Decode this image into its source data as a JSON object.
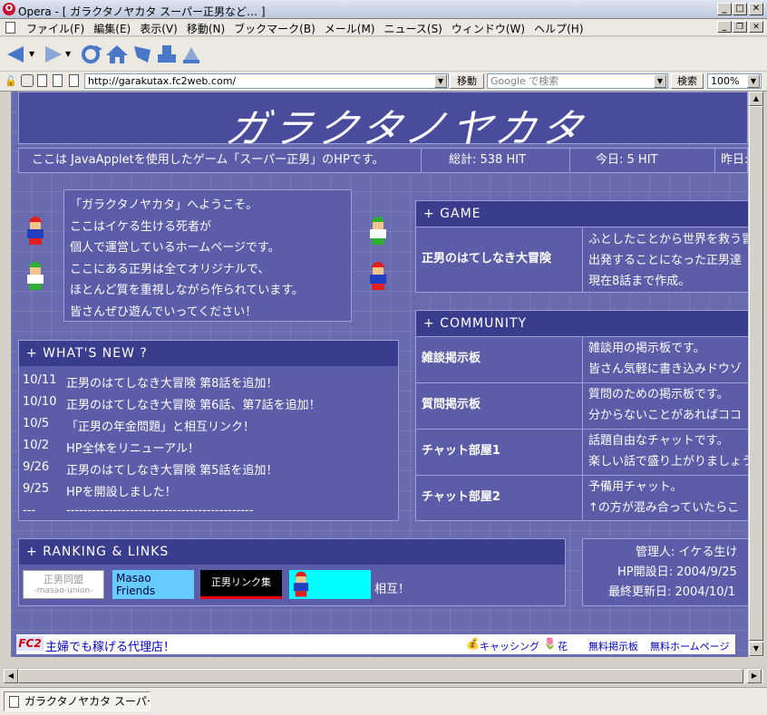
{
  "window": {
    "title": "Opera - [ ガラクタノヤカタ スーパー正男など… ]",
    "min": "_",
    "max": "□",
    "close": "✕"
  },
  "menu": [
    "ファイル(F)",
    "編集(E)",
    "表示(V)",
    "移動(N)",
    "ブックマーク(B)",
    "メール(M)",
    "ニュース(S)",
    "ウィンドウ(W)",
    "ヘルプ(H)"
  ],
  "address": {
    "url": "http://garakutax.fc2web.com/",
    "go": "移動",
    "search_placeholder": "Google で検索",
    "search_btn": "検索",
    "zoom": "100%"
  },
  "site": {
    "logo": "ガラクタノヤカタ",
    "info": {
      "desc": "ここは JavaAppletを使用したゲーム「スーパー正男」のHPです。",
      "total": "総計: 538 HIT",
      "today": "今日: 5 HIT",
      "yesterday": "昨日:"
    },
    "welcome": [
      "「ガラクタノヤカタ」へようこそ。",
      "ここはイケる生ける死者が",
      "個人で運営しているホームページです。",
      "ここにある正男は全てオリジナルで、",
      "ほとんど質を重視しながら作られています。",
      "皆さんぜひ遊んでいってください！"
    ],
    "whatsnew": {
      "title": "+ WHAT'S NEW ?",
      "items": [
        {
          "date": "10/11",
          "text": "正男のはてしなき大冒険 第8話を追加！"
        },
        {
          "date": "10/10",
          "text": "正男のはてしなき大冒険 第6話、第7話を追加！"
        },
        {
          "date": "10/5",
          "text": "「正男の年金問題」と相互リンク！"
        },
        {
          "date": "10/2",
          "text": "HP全体をリニューアル！"
        },
        {
          "date": "9/26",
          "text": "正男のはてしなき大冒険 第5話を追加！"
        },
        {
          "date": "9/25",
          "text": "HPを開設しました！"
        },
        {
          "date": "---",
          "text": "--------------------------------------------"
        }
      ]
    },
    "game": {
      "title": "+ GAME",
      "name": "正男のはてしなき大冒険",
      "desc": [
        "ふとしたことから世界を救う冒",
        "出発することになった正男達",
        "現在8話まで作成。"
      ]
    },
    "community": {
      "title": "+ COMMUNITY",
      "items": [
        {
          "name": "雑談掲示板",
          "d1": "雑談用の掲示板です。",
          "d2": "皆さん気軽に書き込みドウゾ"
        },
        {
          "name": "質問掲示板",
          "d1": "質問のための掲示板です。",
          "d2": "分からないことがあればココ"
        },
        {
          "name": "チャット部屋1",
          "d1": "話題自由なチャットです。",
          "d2": "楽しい話で盛り上がりましょう"
        },
        {
          "name": "チャット部屋2",
          "d1": "予備用チャット。",
          "d2": "↑の方が混み合っていたらこ"
        }
      ]
    },
    "ranking": {
      "title": "+ RANKING & LINKS",
      "b1": "正男同盟",
      "b1s": "-masao-union-",
      "b2a": "Masao",
      "b2b": "Friends",
      "b3": "正男リンク集",
      "mutual": "相互！"
    },
    "admin": {
      "l1": "管理人: イケる生け",
      "l2": "HP開設日: 2004/9/25",
      "l3": "最終更新日: 2004/10/1"
    },
    "fc2": {
      "logo": "FC2",
      "ad": "主婦でも稼げる代理店！",
      "links": [
        "キャッシング",
        "花",
        "無料掲示板",
        "無料ホームページ"
      ]
    }
  },
  "taskbar": {
    "item": "ガラクタノヤカタ スーパー..."
  }
}
